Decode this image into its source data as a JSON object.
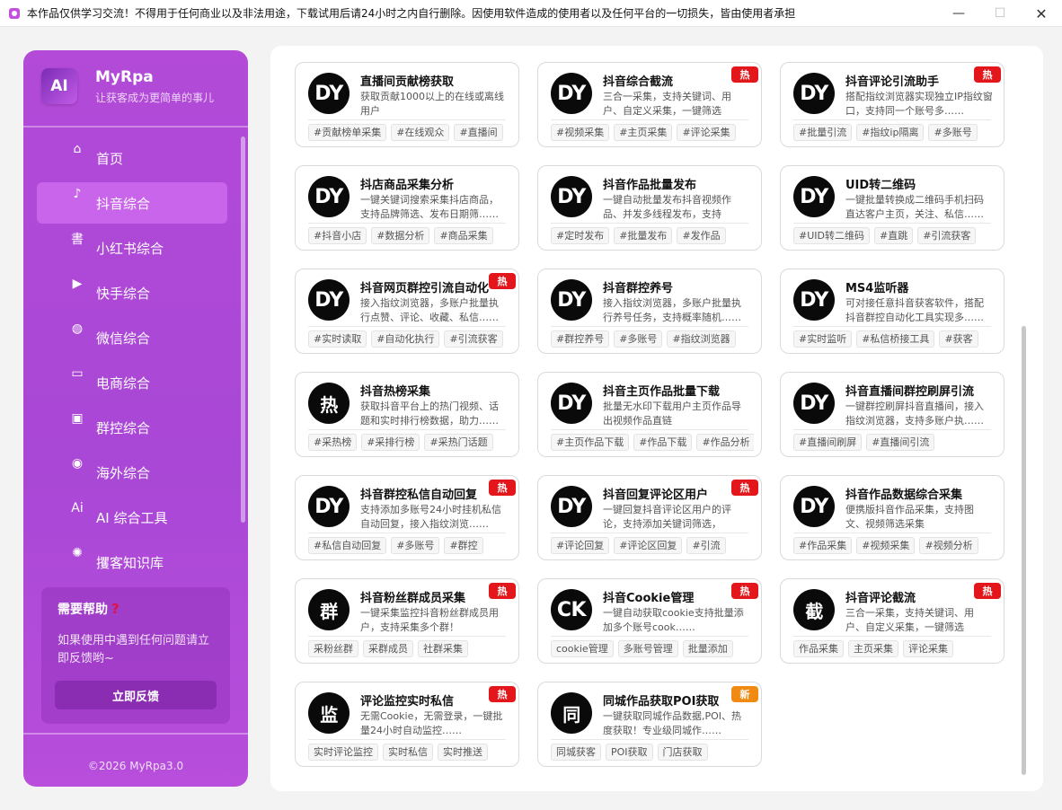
{
  "window": {
    "title": "本作品仅供学习交流！不得用于任何商业以及非法用途，下载试用后请24小时之内自行删除。因使用软件造成的使用者以及任何平台的一切损失，皆由使用者承担",
    "minimize": "—",
    "maximize": "☐",
    "close": "✕"
  },
  "sidebar": {
    "logo": "AI",
    "name": "MyRpa",
    "subtitle": "让获客成为更简单的事儿",
    "items": [
      {
        "label": "首页",
        "icon": "home-icon",
        "glyph": "⌂"
      },
      {
        "label": "抖音综合",
        "icon": "douyin-icon",
        "glyph": "♪"
      },
      {
        "label": "小红书综合",
        "icon": "xiaohongshu-icon",
        "glyph": "書"
      },
      {
        "label": "快手综合",
        "icon": "kuaishou-icon",
        "glyph": "▶"
      },
      {
        "label": "微信综合",
        "icon": "wechat-icon",
        "glyph": "◍"
      },
      {
        "label": "电商综合",
        "icon": "shop-icon",
        "glyph": "▭"
      },
      {
        "label": "群控综合",
        "icon": "group-control-icon",
        "glyph": "▣"
      },
      {
        "label": "海外综合",
        "icon": "globe-icon",
        "glyph": "◉"
      },
      {
        "label": "AI 综合工具",
        "icon": "ai-tool-icon",
        "glyph": "Ai"
      },
      {
        "label": "攫客知识库",
        "icon": "lightbulb-icon",
        "glyph": "✺"
      }
    ],
    "help": {
      "title": "需要帮助",
      "question_mark": "?",
      "text": "如果使用中遇到任何问题请立即反馈哟~",
      "button": "立即反馈"
    },
    "copyright": "©2026 MyRpa3.0"
  },
  "cards": [
    {
      "avatar": "DY",
      "title": "直播间贡献榜获取",
      "desc": "获取贡献1000以上的在线或离线用户",
      "tags": [
        "#贡献榜单采集",
        "#在线观众",
        "#直播间"
      ],
      "badge": ""
    },
    {
      "avatar": "DY",
      "title": "抖音综合截流",
      "desc": "三合一采集，支持关键词、用户、自定义采集，一键筛选符……",
      "tags": [
        "#视频采集",
        "#主页采集",
        "#评论采集"
      ],
      "badge": "热"
    },
    {
      "avatar": "DY",
      "title": "抖音评论引流助手",
      "desc": "搭配指纹浏览器实现独立IP指纹窗口，支持同一个账号多……",
      "tags": [
        "#批量引流",
        "#指纹ip隔离",
        "#多账号"
      ],
      "badge": "热"
    },
    {
      "avatar": "DY",
      "title": "抖店商品采集分析",
      "desc": "一键关键词搜索采集抖店商品，支持品牌筛选、发布日期筛……",
      "tags": [
        "#抖音小店",
        "#数据分析",
        "#商品采集"
      ],
      "badge": ""
    },
    {
      "avatar": "DY",
      "title": "抖音作品批量发布",
      "desc": "一键自动批量发布抖音视频作品、并发多线程发布，支持为……",
      "tags": [
        "#定时发布",
        "#批量发布",
        "#发作品"
      ],
      "badge": ""
    },
    {
      "avatar": "DY",
      "title": "UID转二维码",
      "desc": "一键批量转换成二维码手机扫码直达客户主页，关注、私信……",
      "tags": [
        "#UID转二维码",
        "#直跳",
        "#引流获客"
      ],
      "badge": ""
    },
    {
      "avatar": "DY",
      "title": "抖音网页群控引流自动化",
      "desc": "接入指纹浏览器，多账户批量执行点赞、评论、收藏、私信……",
      "tags": [
        "#实时读取",
        "#自动化执行",
        "#引流获客"
      ],
      "badge": "热"
    },
    {
      "avatar": "DY",
      "title": "抖音群控养号",
      "desc": "接入指纹浏览器，多账户批量执行养号任务，支持概率随机……",
      "tags": [
        "#群控养号",
        "#多账号",
        "#指纹浏览器"
      ],
      "badge": ""
    },
    {
      "avatar": "DY",
      "title": "MS4监听器",
      "desc": "可对接任意抖音获客软件，搭配抖音群控自动化工具实现多……",
      "tags": [
        "#实时监听",
        "#私信桥接工具",
        "#获客"
      ],
      "badge": ""
    },
    {
      "avatar": "热",
      "title": "抖音热榜采集",
      "desc": "获取抖音平台上的热门视频、话题和实时排行榜数据，助力……",
      "tags": [
        "#采热榜",
        "#采排行榜",
        "#采热门话题"
      ],
      "badge": ""
    },
    {
      "avatar": "DY",
      "title": "抖音主页作品批量下载",
      "desc": "批量无水印下载用户主页作品导出视频作品直链",
      "tags": [
        "#主页作品下载",
        "#作品下载",
        "#作品分析"
      ],
      "badge": ""
    },
    {
      "avatar": "DY",
      "title": "抖音直播间群控刷屏引流",
      "desc": "一键群控刷屏抖音直播间，接入指纹浏览器，支持多账户执……",
      "tags": [
        "#直播间刷屏",
        "#直播间引流"
      ],
      "badge": ""
    },
    {
      "avatar": "DY",
      "title": "抖音群控私信自动回复",
      "desc": "支持添加多账号24小时挂机私信自动回复，接入指纹浏览……",
      "tags": [
        "#私信自动回复",
        "#多账号",
        "#群控"
      ],
      "badge": "热"
    },
    {
      "avatar": "DY",
      "title": "抖音回复评论区用户",
      "desc": "一键回复抖音评论区用户的评论，支持添加关键词筛选，回……",
      "tags": [
        "#评论回复",
        "#评论区回复",
        "#引流"
      ],
      "badge": "热"
    },
    {
      "avatar": "DY",
      "title": "抖音作品数据综合采集",
      "desc": "便携版抖音作品采集，支持图文、视频筛选采集",
      "tags": [
        "#作品采集",
        "#视频采集",
        "#视频分析"
      ],
      "badge": ""
    },
    {
      "avatar": "群",
      "title": "抖音粉丝群成员采集",
      "desc": "一键采集监控抖音粉丝群成员用户，支持采集多个群！",
      "tags": [
        "采粉丝群",
        "采群成员",
        "社群采集"
      ],
      "badge": "热"
    },
    {
      "avatar": "CK",
      "title": "抖音Cookie管理",
      "desc": "一键自动获取cookie支持批量添加多个账号cook……",
      "tags": [
        "cookie管理",
        "多账号管理",
        "批量添加"
      ],
      "badge": "热"
    },
    {
      "avatar": "截",
      "title": "抖音评论截流",
      "desc": "三合一采集，支持关键词、用户、自定义采集，一键筛选符……",
      "tags": [
        "作品采集",
        "主页采集",
        "评论采集"
      ],
      "badge": "热"
    },
    {
      "avatar": "监",
      "title": "评论监控实时私信",
      "desc": "无需Cookie，无需登录，一键批量24小时自动监控……",
      "tags": [
        "实时评论监控",
        "实时私信",
        "实时推送"
      ],
      "badge": "热"
    },
    {
      "avatar": "同",
      "title": "同城作品获取POI获取",
      "desc": "一键获取同城作品数据,POI、热度获取！专业级同城作……",
      "tags": [
        "同城获客",
        "POI获取",
        "门店获取"
      ],
      "badge": "新"
    }
  ],
  "colors": {
    "sidebar": "#b34ad8",
    "active": "#c965ea",
    "hot": "#e3171b",
    "new": "#f08a12"
  }
}
